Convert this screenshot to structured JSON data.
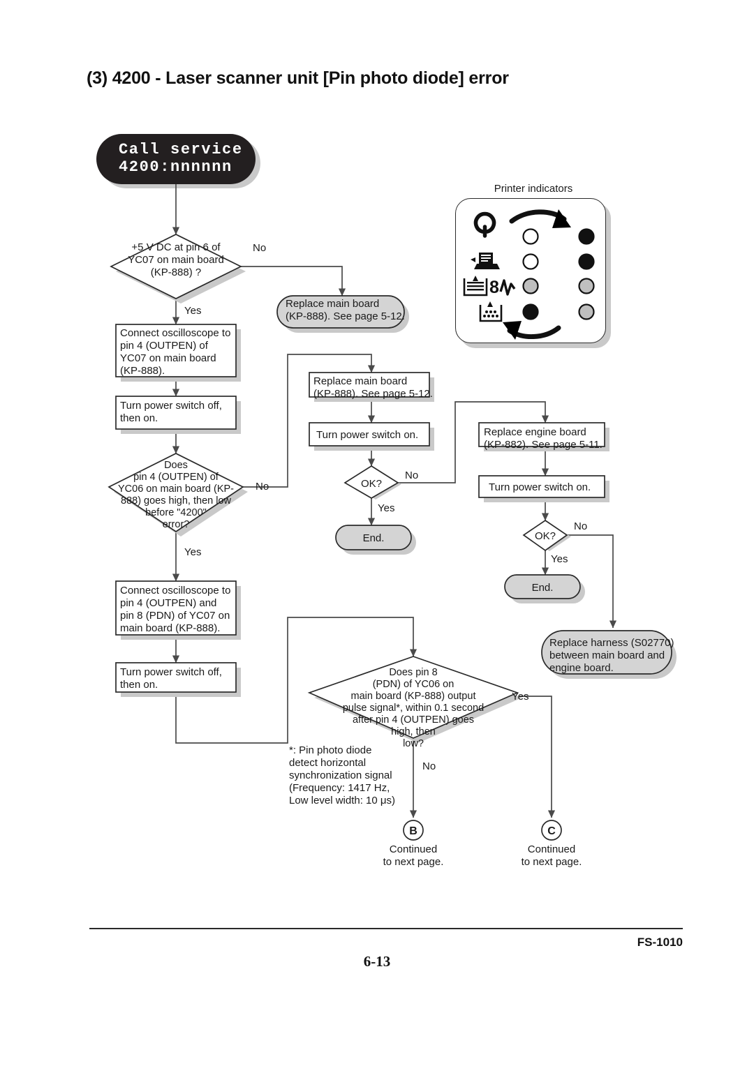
{
  "document": {
    "title": "(3) 4200 - Laser scanner unit [Pin photo diode] error",
    "footer_model": "FS-1010",
    "footer_page": "6-13"
  },
  "lcd_display": {
    "line1": "Call service",
    "line2": "4200:nnnnnn"
  },
  "indicator_panel": {
    "caption": "Printer indicators",
    "rows": [
      {
        "icon": "power-ready-icon",
        "left_state": "off",
        "right_state": "on"
      },
      {
        "icon": "data-paper-feed-icon",
        "left_state": "off",
        "right_state": "on"
      },
      {
        "icon": "attention-icon",
        "left_state": "dim",
        "right_state": "dim"
      },
      {
        "icon": "toner-icon",
        "left_state": "on",
        "right_state": "dim"
      }
    ],
    "extra_icon": "paper-tray-icon",
    "arrow_top": "clockwise-arrow-icon",
    "arrow_bottom": "counterclockwise-arrow-icon"
  },
  "flow": {
    "decisions": {
      "d1": "+5 V DC at pin 6 of YC07 on main board (KP-888) ?",
      "d1_lines": [
        "+5 V DC at pin 6 of",
        "YC07 on main board",
        "(KP-888) ?"
      ],
      "d2_lines": [
        "Does",
        "pin 4 (OUTPEN) of",
        "YC06 on main board (KP-",
        "888) goes high, then low",
        "before \"4200\"",
        "error?"
      ],
      "d3_lines": [
        "Does pin 8",
        "(PDN) of YC06 on",
        "main board (KP-888) output",
        "pulse signal*, within 0.1 second",
        "after pin 4 (OUTPEN) goes",
        "high, then",
        "low?"
      ],
      "ok_mid": "OK?",
      "ok_right": "OK?"
    },
    "processes": {
      "p1_lines": [
        "Connect oscilloscope to",
        "pin 4 (OUTPEN) of",
        "YC07 on main board",
        "(KP-888)."
      ],
      "p2_lines": [
        "Turn power switch off,",
        "then on."
      ],
      "p3_lines": [
        "Connect oscilloscope to",
        "pin 4 (OUTPEN) and",
        "pin 8 (PDN) of YC07 on",
        "main board (KP-888)."
      ],
      "p4_lines": [
        "Turn power switch off,",
        "then on."
      ],
      "m1_lines": [
        "Replace main board",
        "(KP-888). See page 5-12."
      ],
      "m2_lines": [
        "Turn power switch on."
      ],
      "r1_lines": [
        "Replace engine board",
        "(KP-882). See page 5-11."
      ],
      "r2_lines": [
        "Turn power switch on."
      ]
    },
    "terminals": {
      "t1_lines": [
        "Replace main board",
        "(KP-888). See page 5-12."
      ],
      "end_mid": "End.",
      "end_right": "End.",
      "harness_lines": [
        "Replace harness (S02770)",
        "between main board and",
        "engine board."
      ]
    },
    "labels": {
      "yes": "Yes",
      "no": "No"
    },
    "footnote_lines": [
      "*: Pin photo diode",
      "detect horizontal",
      "synchronization signal",
      "(Frequency: 1417 Hz,",
      "Low level width: 10 μs)"
    ],
    "connectors": [
      {
        "letter": "B",
        "caption_line1": "Continued",
        "caption_line2": "to next page."
      },
      {
        "letter": "C",
        "caption_line1": "Continued",
        "caption_line2": "to next page."
      }
    ]
  },
  "colors": {
    "line": "#4a4a4a",
    "shape_border": "#2a2a2a",
    "shadow": "#c9c9c9",
    "terminal_fill": "#d4d4d4",
    "lcd_bg": "#231f20"
  }
}
